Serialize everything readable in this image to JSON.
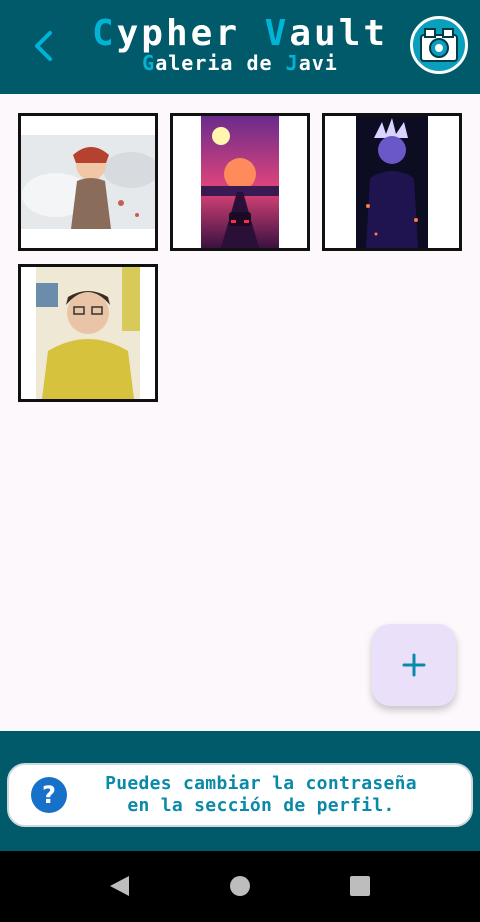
{
  "header": {
    "title_parts": [
      "C",
      "ypher ",
      "V",
      "ault"
    ],
    "subtitle_parts": [
      "G",
      "aleria de ",
      "J",
      "avi"
    ],
    "back_icon": "chevron-left-icon",
    "logo_icon": "cypher-vault-logo"
  },
  "gallery": {
    "images": [
      {
        "name": "anime-warrior-princess-wolves",
        "colors": [
          "#e6e9ec",
          "#b5412f"
        ]
      },
      {
        "name": "synthwave-sunset-road",
        "colors": [
          "#7a2d8c",
          "#ff7a5c"
        ]
      },
      {
        "name": "anime-character-dark-purple",
        "colors": [
          "#0c0c22",
          "#5b3fc5"
        ]
      },
      {
        "name": "selfie-yellow-hoodie",
        "colors": [
          "#d6c23c",
          "#f0d0c0"
        ]
      }
    ]
  },
  "fab": {
    "icon": "plus-icon"
  },
  "hint": {
    "icon": "question-icon",
    "icon_glyph": "?",
    "line1": "Puedes cambiar la contraseña",
    "line2": "en la sección de perfil."
  },
  "system_nav": {
    "back": "nav-back-icon",
    "home": "nav-home-icon",
    "recents": "nav-recents-icon"
  },
  "colors": {
    "primary": "#005a6a",
    "accent": "#00b4d8",
    "hint_text": "#0a8aa8",
    "fab_bg": "#ebe0fa"
  }
}
